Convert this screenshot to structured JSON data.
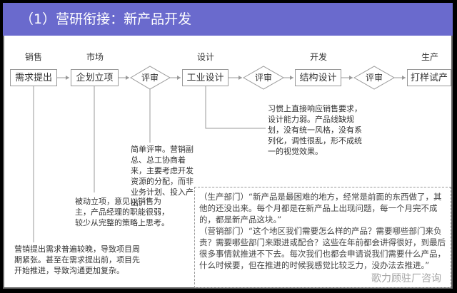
{
  "title": "（1）营研衔接：新产品开发",
  "stages": [
    "销售",
    "市场",
    "设计",
    "开发",
    "生产"
  ],
  "steps": [
    "需求提出",
    "企划立项",
    "评审",
    "工业设计",
    "评审",
    "结构设计",
    "评审",
    "打样试产"
  ],
  "notes": {
    "sales": "营销提出需求普遍较晚，导致项目周期紧张。甚至在需求提出前，项目先开始推进，导致沟通更加复杂。",
    "planning": "被动立项，意见以销售为主，产品经理的职能很弱，较少从完整的策略上思考。",
    "review": "简单评审。营销副总、总工协商着来，主要考虑开发资源的分配，而非业务计划、投入产出。",
    "design": "习惯上直接响应销售要求，设计能力弱。产品线缺规划，没有统一风格，没有系列化，调性很乱，形不成统一的视觉效果。"
  },
  "quotes": {
    "production": "（生产部门）“新产品是最困难的地方，经常是前面的东西做了，其他的还没出来。每个月都是在新产品上出现问题，每一个月完不成的，都是新产品这块。”",
    "marketing": "（营销部门）“这个地区我们需要怎么样的产品？需要哪些部门来负责？需要哪些部门来跟进或配合？这些在年前都会讲得很好，到最后很多事情就推进不下去。每次我们也都会申请说我们需要什么产品，什么时候要，但在推进的时候我感觉比较乏力，没办法去推进。”"
  },
  "watermark": "歌力顾驻厂咨询"
}
